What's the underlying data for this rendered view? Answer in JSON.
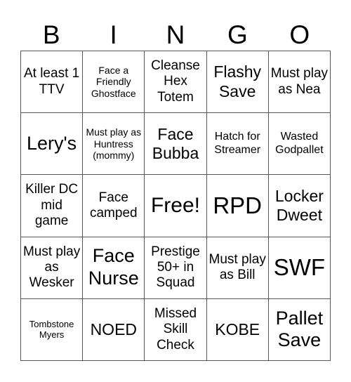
{
  "header": {
    "letters": [
      "B",
      "I",
      "N",
      "G",
      "O"
    ]
  },
  "board": {
    "rows": [
      [
        "At least 1 TTV",
        "Face a Friendly Ghostface",
        "Cleanse Hex Totem",
        "Flashy Save",
        "Must play as Nea"
      ],
      [
        "Lery's",
        "Must play as Huntress (mommy)",
        "Face Bubba",
        "Hatch for Streamer",
        "Wasted Godpallet"
      ],
      [
        "Killer DC mid game",
        "Face camped",
        "Free!",
        "RPD",
        "Locker Dweet"
      ],
      [
        "Must play as Wesker",
        "Face Nurse",
        "Prestige 50+ in Squad",
        "Must play as Bill",
        "SWF"
      ],
      [
        "Tombstone Myers",
        "NOED",
        "Missed Skill Check",
        "KOBE",
        "Pallet Save"
      ]
    ]
  }
}
